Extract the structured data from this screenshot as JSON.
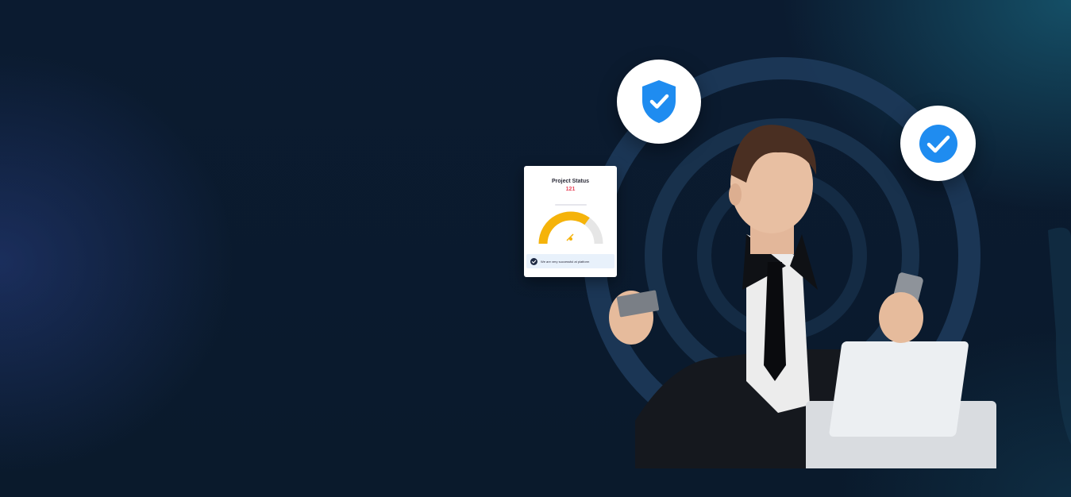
{
  "hero": {
    "colors": {
      "background": "#0b1a2d",
      "ring": "#1d3a5a",
      "accent_blue": "#1f8cf0",
      "gauge_fill": "#f5b30a",
      "gauge_track": "#e6e6e6",
      "count_color": "#e8455a"
    },
    "icons": {
      "shield": "shield-check-icon",
      "badge": "check-circle-icon",
      "footer": "check-circle-icon"
    }
  },
  "status_card": {
    "title": "Project Status",
    "count": "121",
    "footer_text": "We are very successful at platform",
    "gauge_progress": 0.7
  }
}
